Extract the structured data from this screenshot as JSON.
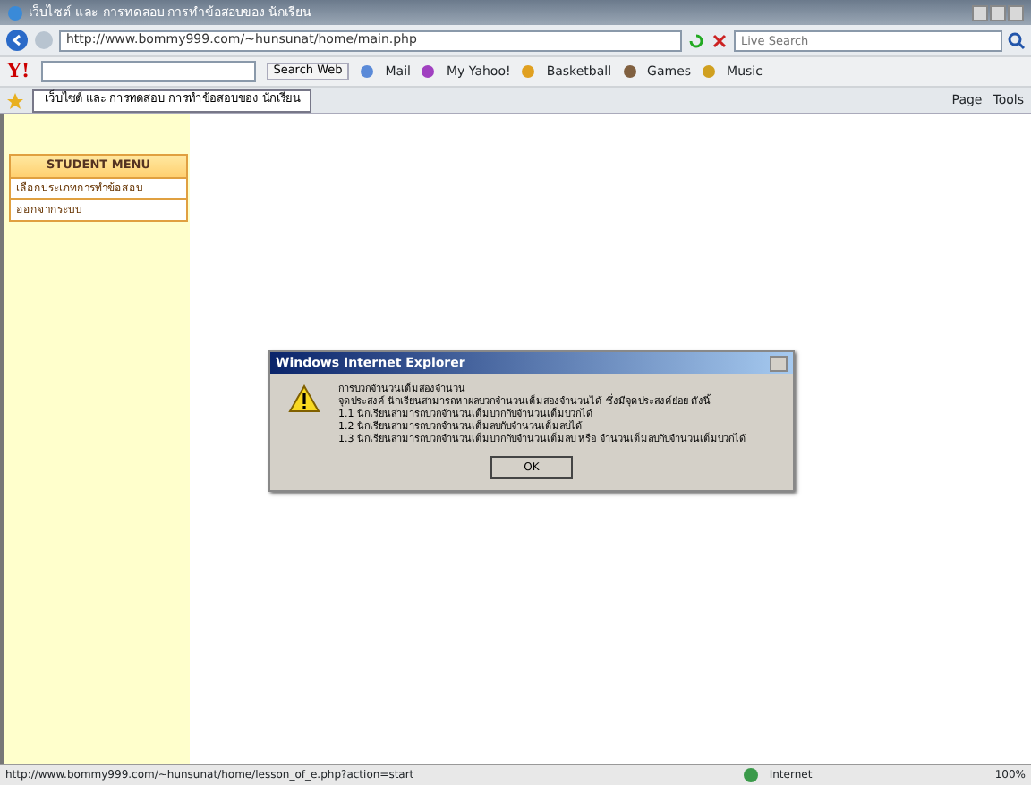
{
  "window": {
    "title": "เว็บไซต์ และ การทดสอบ การทำข้อสอบของ นักเรียน"
  },
  "address_bar": {
    "url": "http://www.bommy999.com/~hunsunat/home/main.php",
    "search": {
      "placeholder": "Live Search"
    }
  },
  "yahoo_toolbar": {
    "logo": "Y!",
    "search_button": "Search Web",
    "links": [
      "Mail",
      "My Yahoo!",
      "Basketball",
      "Games",
      "Music"
    ]
  },
  "tabs": [
    {
      "label": "เว็บไซต์ และ การทดสอบ การทำข้อสอบของ นักเรียน",
      "selected": true
    }
  ],
  "command_bar": [
    "Page",
    "Tools"
  ],
  "sidebar": {
    "title": "STUDENT MENU",
    "items": [
      "เลือกประเภทการทำข้อสอบ",
      "ออกจากระบบ"
    ]
  },
  "dialog": {
    "title": "Windows Internet Explorer",
    "lines": [
      "การบวกจำนวนเต็มสองจำนวน",
      "จุดประสงค์ นักเรียนสามารถหาผลบวกจำนวนเต็มสองจำนวนได้ ซึ่งมีจุดประสงค์ย่อย ดังนี้",
      "1.1 นักเรียนสามารถบวกจำนวนเต็มบวกกับจำนวนเต็มบวกได้",
      "1.2 นักเรียนสามารถบวกจำนวนเต็มลบกับจำนวนเต็มลบได้",
      "1.3 นักเรียนสามารถบวกจำนวนเต็มบวกกับจำนวนเต็มลบ หรือ จำนวนเต็มลบกับจำนวนเต็มบวกได้"
    ],
    "button": "OK"
  },
  "status_bar": {
    "url": "http://www.bommy999.com/~hunsunat/home/lesson_of_e.php?action=start",
    "zone": "Internet",
    "zoom": "100%"
  }
}
